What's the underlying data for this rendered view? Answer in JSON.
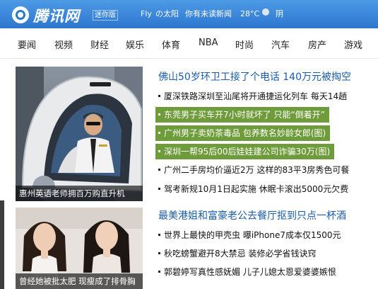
{
  "header": {
    "brand": "腾讯网",
    "edition": "迷你版",
    "user": "Fly",
    "user_suffix": "の太阳",
    "messages": "你有未读新闻",
    "temperature": "28°C",
    "weather": "阴"
  },
  "nav": [
    "要闻",
    "视频",
    "财经",
    "娱乐",
    "体育",
    "NBA",
    "时尚",
    "汽车",
    "房产",
    "游戏"
  ],
  "section1": {
    "image_caption": "惠州英语老师拥百万购直升机",
    "headline": "佛山50岁环卫工接了个电话 140万元被掏空",
    "items": [
      "厦深铁路深圳至汕尾将开通捷运化列车  每天14趟",
      "东莞男子买车开7小时就坏了  只能“倒着开”",
      "广州男子卖奶茶毒品  包养数名妙龄女郎(图)",
      "深圳一帮95后00后娃娃建公司诈骗30万(图)",
      "广州二手房均价逼近2万  这样的83平3房秀色可餐",
      "驾考新规10月1日起实施  休眠卡滚出5000元欠费"
    ]
  },
  "section2": {
    "image_caption": "曾经她被批太肥  现瘦成了排骨胸",
    "headline": "最美港姐和富豪老公去餐厅抠到只点一杯酒",
    "items": [
      "世界上最快的甲壳虫  曝iPhone7成本仅1500元",
      "秋吃螃蟹避开8大禁忌  装修必学省钱诀窍",
      "郭碧婷写真性感妩媚  儿子儿媳太恩爱婆婆嫉恨"
    ]
  },
  "colors": {
    "topbar": "#2d76cf",
    "headline": "#1a5caa",
    "highlight": "#6f9c3a"
  },
  "icons": [
    "qq-logo-icon",
    "weather-cloudy-icon"
  ]
}
